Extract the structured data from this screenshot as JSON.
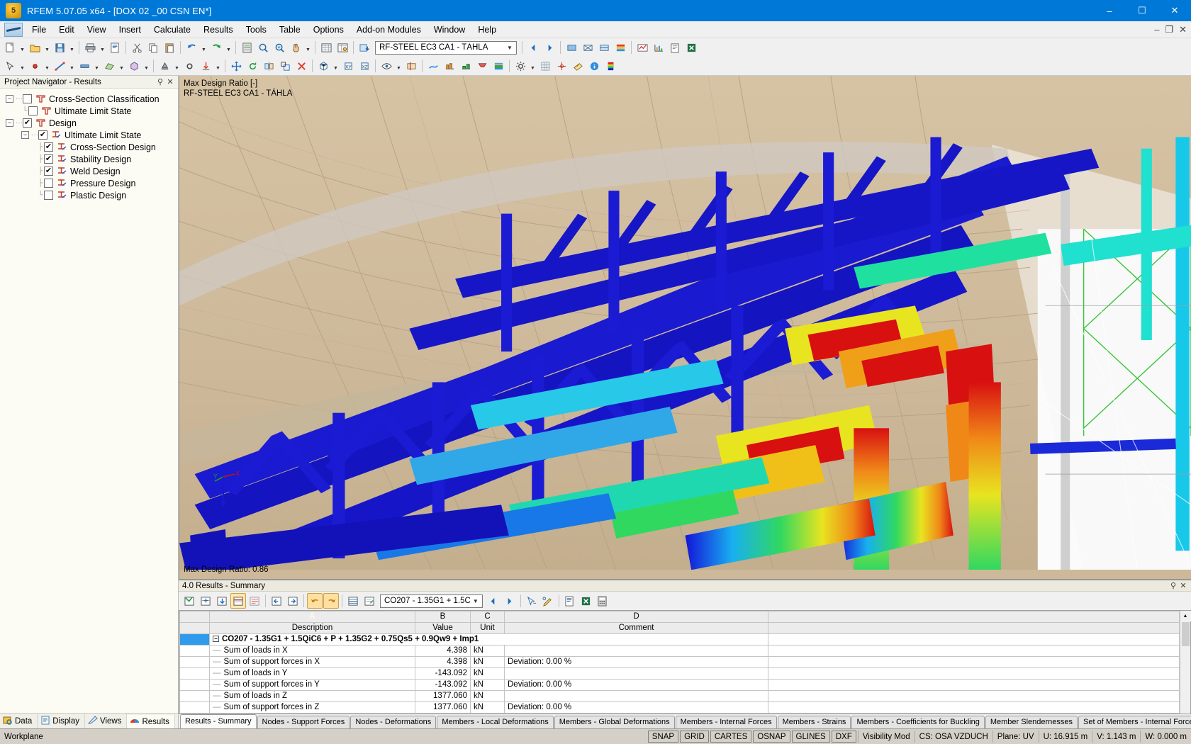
{
  "window": {
    "title": "RFEM 5.07.05 x64 - [DOX 02 _00 CSN EN*]",
    "app_icon": "rfem-logo-icon",
    "minimize": "–",
    "maximize": "☐",
    "close": "✕",
    "inner_minimize": "–",
    "inner_restore": "❐",
    "inner_close": "✕"
  },
  "menu": {
    "items": [
      {
        "label": "File"
      },
      {
        "label": "Edit"
      },
      {
        "label": "View"
      },
      {
        "label": "Insert"
      },
      {
        "label": "Calculate"
      },
      {
        "label": "Results"
      },
      {
        "label": "Tools"
      },
      {
        "label": "Table"
      },
      {
        "label": "Options"
      },
      {
        "label": "Add-on Modules"
      },
      {
        "label": "Window"
      },
      {
        "label": "Help"
      }
    ]
  },
  "toolbar": {
    "module_combo_value": "RF-STEEL EC3 CA1 - TÁHLA",
    "module_combo_arrow": "▼"
  },
  "navigator": {
    "title": "Project Navigator - Results",
    "pin_icon": "pin-icon",
    "close_icon": "close-icon",
    "tree": [
      {
        "label": "Cross-Section Classification",
        "level": 1,
        "expander": "−",
        "checked": false,
        "icon": "cross-section-icon"
      },
      {
        "label": "Ultimate Limit State",
        "level": 2,
        "expander": "",
        "checked": false,
        "icon": "cross-section-icon"
      },
      {
        "label": "Design",
        "level": 1,
        "expander": "−",
        "checked": true,
        "icon": "cross-section-icon"
      },
      {
        "label": "Ultimate Limit State",
        "level": 2,
        "expander": "−",
        "checked": true,
        "icon": "design-icon"
      },
      {
        "label": "Cross-Section Design",
        "level": 3,
        "expander": "",
        "checked": true,
        "icon": "design-icon"
      },
      {
        "label": "Stability Design",
        "level": 3,
        "expander": "",
        "checked": true,
        "icon": "design-icon"
      },
      {
        "label": "Weld Design",
        "level": 3,
        "expander": "",
        "checked": true,
        "icon": "design-icon"
      },
      {
        "label": "Pressure Design",
        "level": 3,
        "expander": "",
        "checked": false,
        "icon": "design-icon"
      },
      {
        "label": "Plastic Design",
        "level": 3,
        "expander": "",
        "checked": false,
        "icon": "design-icon"
      }
    ],
    "tabs": [
      {
        "label": "Data",
        "icon": "data-icon",
        "active": false
      },
      {
        "label": "Display",
        "icon": "display-icon",
        "active": false
      },
      {
        "label": "Views",
        "icon": "views-icon",
        "active": false
      },
      {
        "label": "Results",
        "icon": "results-icon",
        "active": true
      }
    ]
  },
  "viewport": {
    "label_line1": "Max Design Ratio [-]",
    "label_line2": "RF-STEEL EC3 CA1 - TÁHLA",
    "max_design_ratio": "Max Design Ratio: 0.86",
    "axis_x": "X",
    "axis_y": "Y",
    "axis_z": "Z"
  },
  "results_panel": {
    "title": "4.0 Results - Summary",
    "pin_icon": "pin-icon",
    "close_icon": "close-icon",
    "load_case_combo": "CO207 - 1.35G1 + 1.5C",
    "combo_arrow": "▼",
    "prev_icon": "previous-icon",
    "next_icon": "next-icon",
    "table": {
      "column_letters": [
        "",
        "A",
        "B",
        "C",
        "D"
      ],
      "headers": [
        "",
        "Description",
        "Value",
        "Unit",
        "Comment"
      ],
      "group_row": "CO207 - 1.35G1 + 1.5QiC6 + P + 1.35G2 + 0.75Qs5 + 0.9Qw9 + Imp1",
      "group_expander": "−",
      "rows": [
        {
          "description": "Sum of loads in X",
          "value": "4.398",
          "unit": "kN",
          "comment": ""
        },
        {
          "description": "Sum of support forces in X",
          "value": "4.398",
          "unit": "kN",
          "comment": "Deviation:  0.00 %"
        },
        {
          "description": "Sum of loads in Y",
          "value": "-143.092",
          "unit": "kN",
          "comment": ""
        },
        {
          "description": "Sum of support forces in Y",
          "value": "-143.092",
          "unit": "kN",
          "comment": "Deviation:  0.00 %"
        },
        {
          "description": "Sum of loads in Z",
          "value": "1377.060",
          "unit": "kN",
          "comment": ""
        },
        {
          "description": "Sum of support forces in Z",
          "value": "1377.060",
          "unit": "kN",
          "comment": "Deviation:  0.00 %"
        }
      ]
    },
    "tabs": [
      {
        "label": "Results - Summary",
        "active": true
      },
      {
        "label": "Nodes - Support Forces",
        "active": false
      },
      {
        "label": "Nodes - Deformations",
        "active": false
      },
      {
        "label": "Members - Local Deformations",
        "active": false
      },
      {
        "label": "Members - Global Deformations",
        "active": false
      },
      {
        "label": "Members - Internal Forces",
        "active": false
      },
      {
        "label": "Members - Strains",
        "active": false
      },
      {
        "label": "Members - Coefficients for Buckling",
        "active": false
      },
      {
        "label": "Member Slendernesses",
        "active": false
      },
      {
        "label": "Set of Members - Internal Forces",
        "active": false
      }
    ],
    "tab_nav": [
      "◀◀",
      "◀",
      "▶",
      "▶▶"
    ]
  },
  "statusbar": {
    "left_text": "Workplane",
    "cells": [
      "SNAP",
      "GRID",
      "CARTES",
      "OSNAP",
      "GLINES",
      "DXF"
    ],
    "visibility": "Visibility Mod",
    "cs": "CS: OSA VZDUCH",
    "plane": "Plane: UV",
    "u": "U:  16.915 m",
    "v": "V:  1.143 m",
    "w": "W:  0.000 m"
  },
  "colors": {
    "title_blue": "#0078d7",
    "accent_blue": "#2f9bea",
    "panel_gray": "#f0f0f0",
    "navigator_bg": "#fcfcf5",
    "statusbar": "#d4d0c8",
    "viewport_bg": "#cdb99a"
  }
}
